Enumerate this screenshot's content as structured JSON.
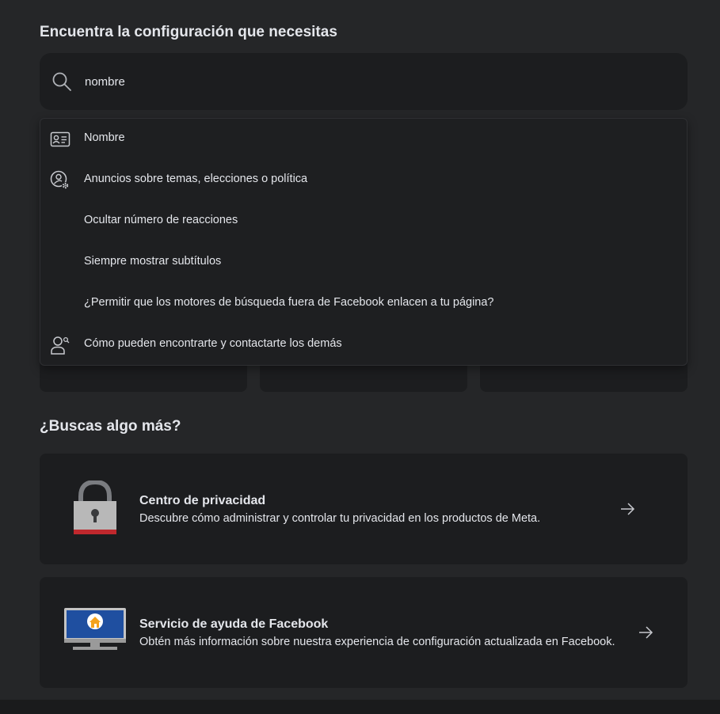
{
  "heading": "Encuentra la configuración que necesitas",
  "search": {
    "value": "nombre",
    "icon": "search-icon"
  },
  "suggestions": [
    {
      "label": "Nombre",
      "icon": "id-card-icon"
    },
    {
      "label": "Anuncios sobre temas, elecciones o política",
      "icon": "user-settings-icon"
    },
    {
      "label": "Ocultar número de reacciones",
      "icon": ""
    },
    {
      "label": "Siempre mostrar subtítulos",
      "icon": ""
    },
    {
      "label": "¿Permitir que los motores de búsqueda fuera de Facebook enlacen a tu página?",
      "icon": ""
    },
    {
      "label": "Cómo pueden encontrarte y contactarte los demás",
      "icon": "user-search-icon"
    }
  ],
  "more": {
    "heading": "¿Buscas algo más?",
    "cards": [
      {
        "title": "Centro de privacidad",
        "description": "Descubre cómo administrar y controlar tu privacidad en los productos de Meta.",
        "icon": "padlock-icon"
      },
      {
        "title": "Servicio de ayuda de Facebook",
        "description": "Obtén más información sobre nuestra experiencia de configuración actualizada en Facebook.",
        "icon": "monitor-home-icon"
      }
    ]
  },
  "colors": {
    "background": "#252628",
    "card": "#1c1d1f",
    "text": "#e4e6eb",
    "padlock_gray": "#b8b8b8",
    "padlock_red": "#c0282d",
    "monitor_blue": "#1f4fa0",
    "home_orange": "#f4a21c"
  }
}
